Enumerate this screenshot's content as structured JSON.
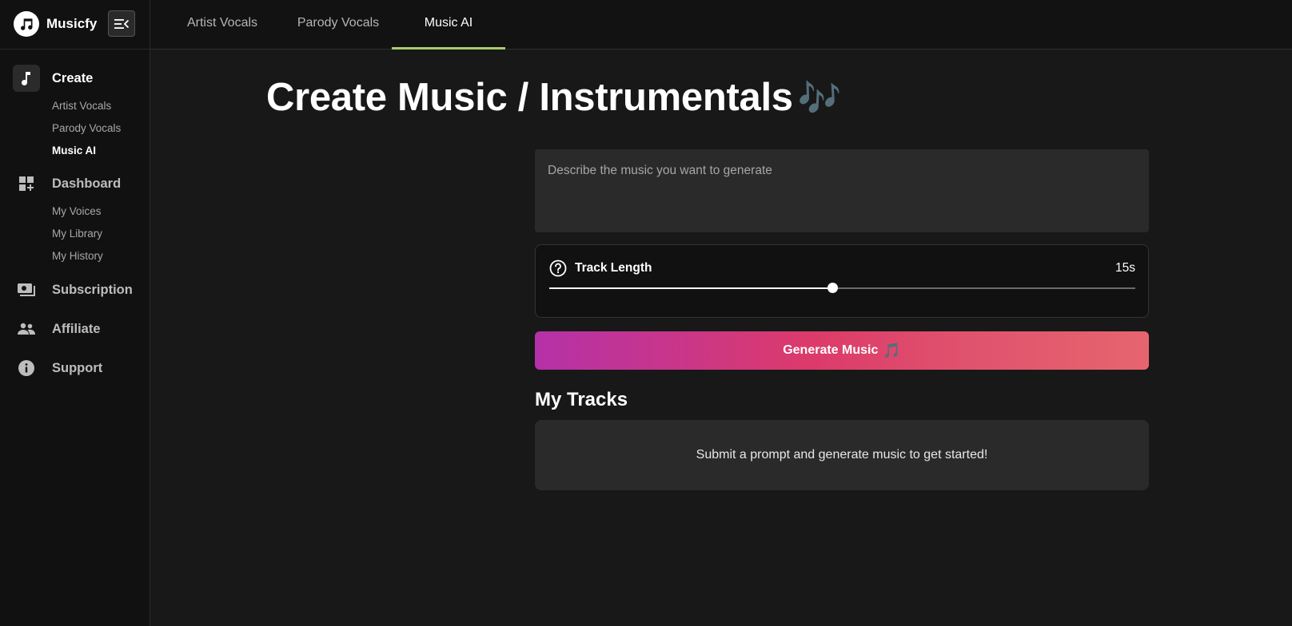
{
  "brand": {
    "name": "Musicfy",
    "logo_icon": "music-note-circle-icon"
  },
  "sidebar": {
    "collapse_icon": "menu-collapse-icon",
    "groups": [
      {
        "label": "Create",
        "icon": "music-note-icon",
        "active": true,
        "items": [
          {
            "label": "Artist Vocals",
            "active": false
          },
          {
            "label": "Parody Vocals",
            "active": false
          },
          {
            "label": "Music AI",
            "active": true
          }
        ]
      },
      {
        "label": "Dashboard",
        "icon": "dashboard-add-icon",
        "active": false,
        "items": [
          {
            "label": "My Voices"
          },
          {
            "label": "My Library"
          },
          {
            "label": "My History"
          }
        ]
      },
      {
        "label": "Subscription",
        "icon": "payments-icon",
        "active": false,
        "items": []
      },
      {
        "label": "Affiliate",
        "icon": "people-icon",
        "active": false,
        "items": []
      },
      {
        "label": "Support",
        "icon": "info-icon",
        "active": false,
        "items": []
      }
    ]
  },
  "header": {
    "tabs": [
      {
        "label": "Artist Vocals",
        "active": false
      },
      {
        "label": "Parody Vocals",
        "active": false
      },
      {
        "label": "Music AI",
        "active": true
      }
    ],
    "accent_color": "#a8cc6a"
  },
  "main": {
    "title": "Create Music / Instrumentals",
    "title_emoji": "🎶",
    "prompt": {
      "value": "",
      "placeholder": "Describe the music you want to generate"
    },
    "track_length": {
      "label": "Track Length",
      "value_label": "15s",
      "slider_fraction": 0.483,
      "help_icon": "question-circle-icon"
    },
    "generate_button": {
      "label": "Generate Music",
      "emoji": "🎵",
      "gradient": [
        "#b531a8",
        "#dc3a6a",
        "#e6656f"
      ]
    },
    "tracks": {
      "title": "My Tracks",
      "empty_message": "Submit a prompt and generate music to get started!"
    }
  }
}
